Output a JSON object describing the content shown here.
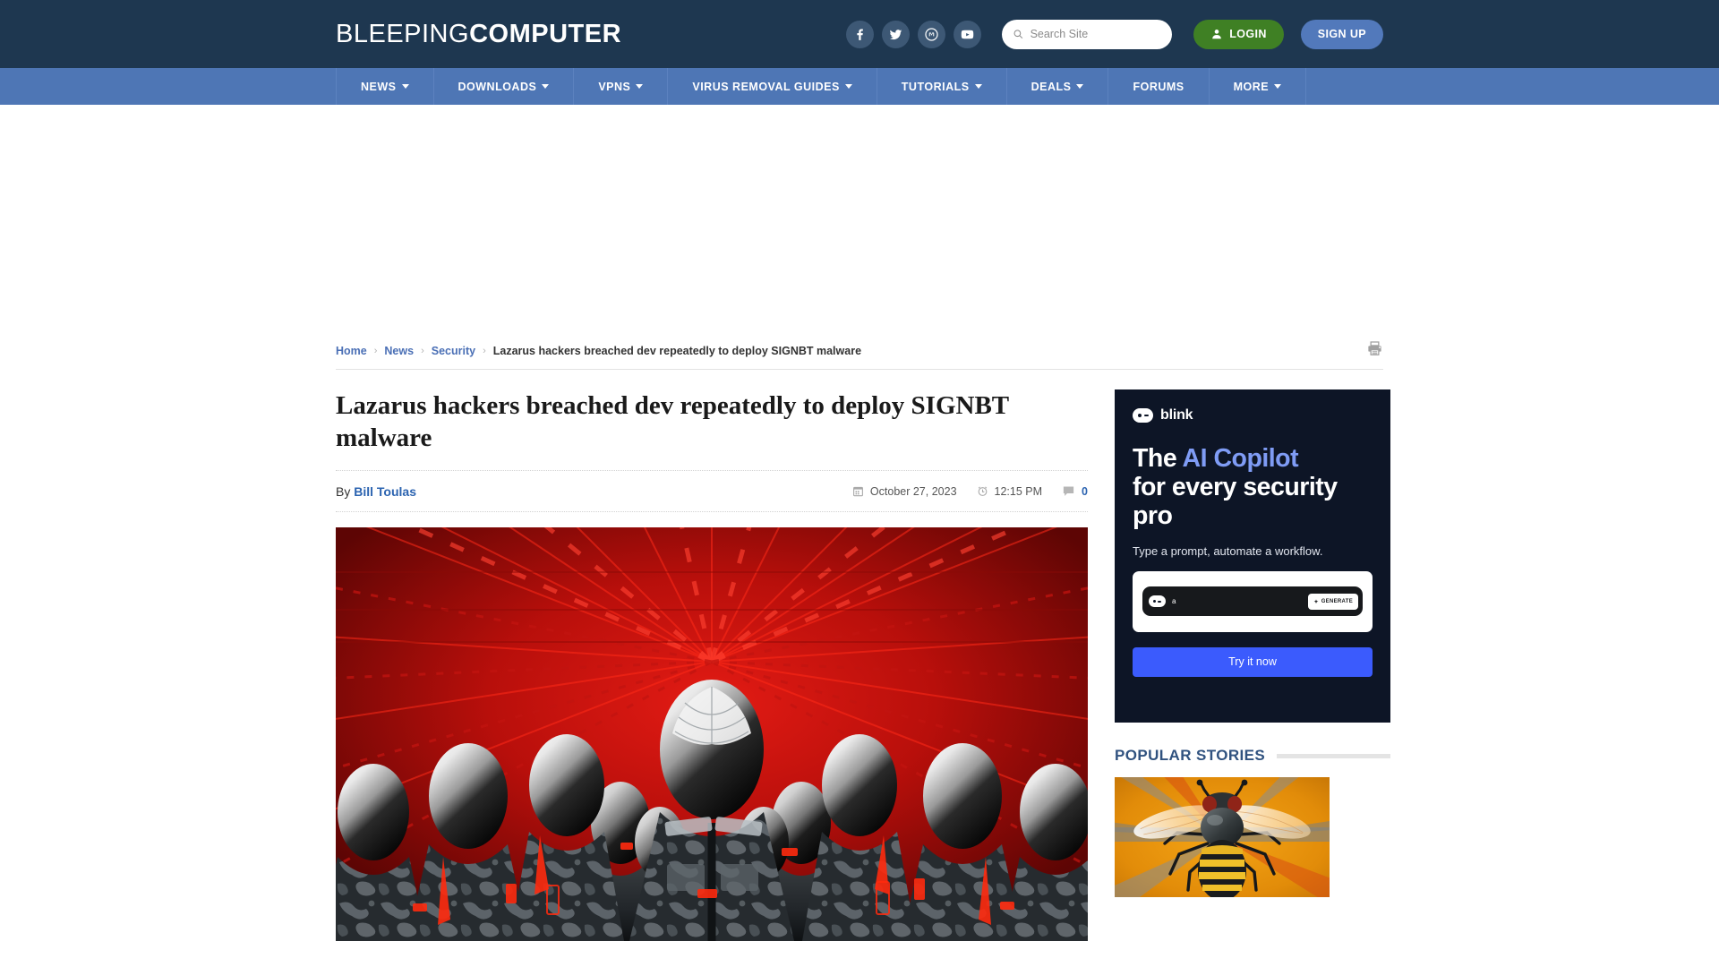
{
  "header": {
    "logo_light": "BLEEPING",
    "logo_bold": "COMPUTER",
    "social": [
      {
        "name": "facebook-icon",
        "label": "Facebook"
      },
      {
        "name": "twitter-icon",
        "label": "Twitter"
      },
      {
        "name": "mastodon-icon",
        "label": "Mastodon"
      },
      {
        "name": "youtube-icon",
        "label": "YouTube"
      }
    ],
    "search_placeholder": "Search Site",
    "search_value": "",
    "login_label": "LOGIN",
    "signup_label": "SIGN UP",
    "bg_color": "#1e3750"
  },
  "nav": {
    "bg_color": "#4e76b5",
    "items": [
      {
        "label": "NEWS",
        "has_caret": true
      },
      {
        "label": "DOWNLOADS",
        "has_caret": true
      },
      {
        "label": "VPNS",
        "has_caret": true
      },
      {
        "label": "VIRUS REMOVAL GUIDES",
        "has_caret": true
      },
      {
        "label": "TUTORIALS",
        "has_caret": true
      },
      {
        "label": "DEALS",
        "has_caret": true
      },
      {
        "label": "FORUMS",
        "has_caret": false
      },
      {
        "label": "MORE",
        "has_caret": true
      }
    ]
  },
  "breadcrumb": {
    "items": [
      {
        "label": "Home",
        "link": true
      },
      {
        "label": "News",
        "link": true
      },
      {
        "label": "Security",
        "link": true
      },
      {
        "label": "Lazarus hackers breached dev repeatedly to deploy SIGNBT malware",
        "link": false
      }
    ],
    "separator": "›",
    "print_icon": "print-icon"
  },
  "article": {
    "title": "Lazarus hackers breached dev repeatedly to deploy SIGNBT malware",
    "by_prefix": "By",
    "author": "Bill Toulas",
    "date": "October 27, 2023",
    "time": "12:15 PM",
    "comment_count": "0",
    "hero_alt": "Rows of figures in dark camouflage uniforms with reflective chrome helmets against a red corridor"
  },
  "sidebar": {
    "ad": {
      "brand": "blink",
      "headline_plain_1": "The ",
      "headline_accent": "AI Copilot",
      "headline_plain_2": "for every security pro",
      "subtext": "Type a prompt, automate a workflow.",
      "prompt_value": "a",
      "generate_label": "GENERATE",
      "cta_label": "Try it now",
      "bg_color": "#0d1526",
      "accent_color": "#7f9cf5",
      "cta_color": "#3b5bfd"
    },
    "popular": {
      "title": "POPULAR STORIES",
      "thumb_alt": "Illustration of a bee on an orange radial burst background"
    }
  }
}
